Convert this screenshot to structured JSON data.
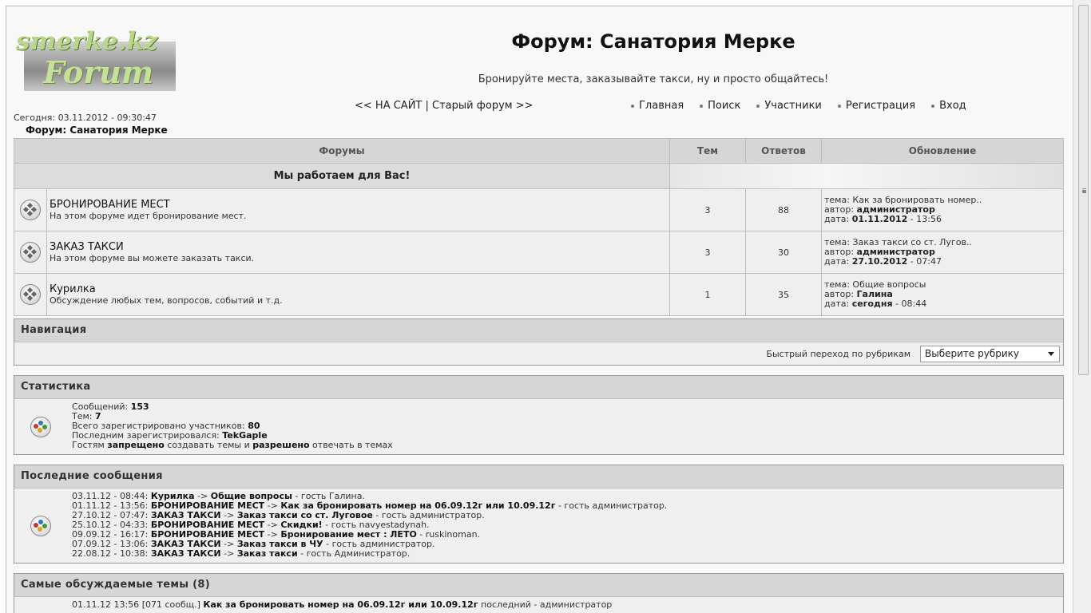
{
  "header": {
    "logo_top": "smerke.kz",
    "logo_bottom": "Forum",
    "title": "Форум: Санатория Мерке",
    "subtitle": "Бронируйте места, заказывайте такси, ну и просто общайтесь!",
    "site_link": "<< НА САЙТ",
    "separator": "|",
    "old_forum_link": "Старый форум >>",
    "nav": [
      "Главная",
      "Поиск",
      "Участники",
      "Регистрация",
      "Вход"
    ],
    "today": "Сегодня: 03.11.2012 - 09:30:47",
    "breadcrumb": "Форум: Санатория Мерке"
  },
  "forums_table": {
    "columns": [
      "Форумы",
      "Тем",
      "Ответов",
      "Обновление"
    ],
    "category": "Мы работаем для Вас!",
    "last_labels": {
      "topic": "тема: ",
      "author": "автор: ",
      "date": "дата: "
    },
    "rows": [
      {
        "title": "БРОНИРОВАНИЕ МЕСТ",
        "desc": "На этом форуме идет бронирование мест.",
        "topics": "3",
        "replies": "88",
        "last_topic": "Как за бронировать номер..",
        "last_author": "администратор",
        "last_date": "01.11.2012",
        "last_time": " - 13:56"
      },
      {
        "title": "ЗАКАЗ ТАКСИ",
        "desc": "На этом форуме вы можете заказать такси.",
        "topics": "3",
        "replies": "30",
        "last_topic": "Заказ такси со ст. Лугов..",
        "last_author": "администратор",
        "last_date": "27.10.2012",
        "last_time": " - 07:47"
      },
      {
        "title": "Курилка",
        "desc": "Обсуждение любых тем, вопросов, событий и т.д.",
        "topics": "1",
        "replies": "35",
        "last_topic": "Общие вопросы",
        "last_author": "Галина",
        "last_date": "сегодня",
        "last_time": " - 08:44"
      }
    ]
  },
  "navigation": {
    "title": "Навигация",
    "jump_label": "Быстрый переход по рубрикам",
    "select_value": "Выберите рубрику"
  },
  "stats": {
    "title": "Статистика",
    "messages_label": "Сообщений: ",
    "messages": "153",
    "topics_label": "Тем: ",
    "topics": "7",
    "users_label": "Всего зарегистрировано участников: ",
    "users": "80",
    "last_user_label": "Последним зарегистрировался: ",
    "last_user": "TekGaple",
    "guests_a": "Гостям ",
    "guests_forbidden": "запрещено",
    "guests_b": " создавать темы и ",
    "guests_allowed": "разрешено",
    "guests_c": " отвечать в темах"
  },
  "recent": {
    "title": "Последние сообщения",
    "items": [
      {
        "time": "03.11.12 - 08:44: ",
        "forum": "Курилка",
        "arrow": " -> ",
        "topic": "Общие вопросы",
        "tail": " - гость Галина."
      },
      {
        "time": "01.11.12 - 13:56: ",
        "forum": "БРОНИРОВАНИЕ МЕСТ",
        "arrow": " -> ",
        "topic": "Как за бронировать номер на 06.09.12г или 10.09.12г",
        "tail": " - гость администратор."
      },
      {
        "time": "27.10.12 - 07:47: ",
        "forum": "ЗАКАЗ ТАКСИ",
        "arrow": " -> ",
        "topic": "Заказ такси со ст. Луговое",
        "tail": " - гость администратор."
      },
      {
        "time": "25.10.12 - 04:33: ",
        "forum": "БРОНИРОВАНИЕ МЕСТ",
        "arrow": " -> ",
        "topic": "Скидки!",
        "tail": " - гость navyestadynah."
      },
      {
        "time": "09.09.12 - 16:17: ",
        "forum": "БРОНИРОВАНИЕ МЕСТ",
        "arrow": " -> ",
        "topic": "Бронирование мест : ЛЕТО",
        "tail": " - ruskinoman."
      },
      {
        "time": "07.09.12 - 13:06: ",
        "forum": "ЗАКАЗ ТАКСИ",
        "arrow": " -> ",
        "topic": "Заказ такси в ЧУ",
        "tail": " - гость администратор."
      },
      {
        "time": "22.08.12 - 10:38: ",
        "forum": "ЗАКАЗ ТАКСИ",
        "arrow": " -> ",
        "topic": "Заказ такси",
        "tail": " - гость Администратор."
      }
    ]
  },
  "popular": {
    "title": "Самые обсуждаемые темы (8)",
    "first": {
      "time": "01.11.12 13:56 ",
      "count": "[071 сообщ.]",
      "topic": "Как за бронировать номер на 06.09.12г или 10.09.12г",
      "tail": " последний - администратор"
    }
  },
  "colors": {
    "panel_header": "#d6d6d6",
    "row_bg": "#efefef",
    "logo_green": "#b8d68c"
  }
}
